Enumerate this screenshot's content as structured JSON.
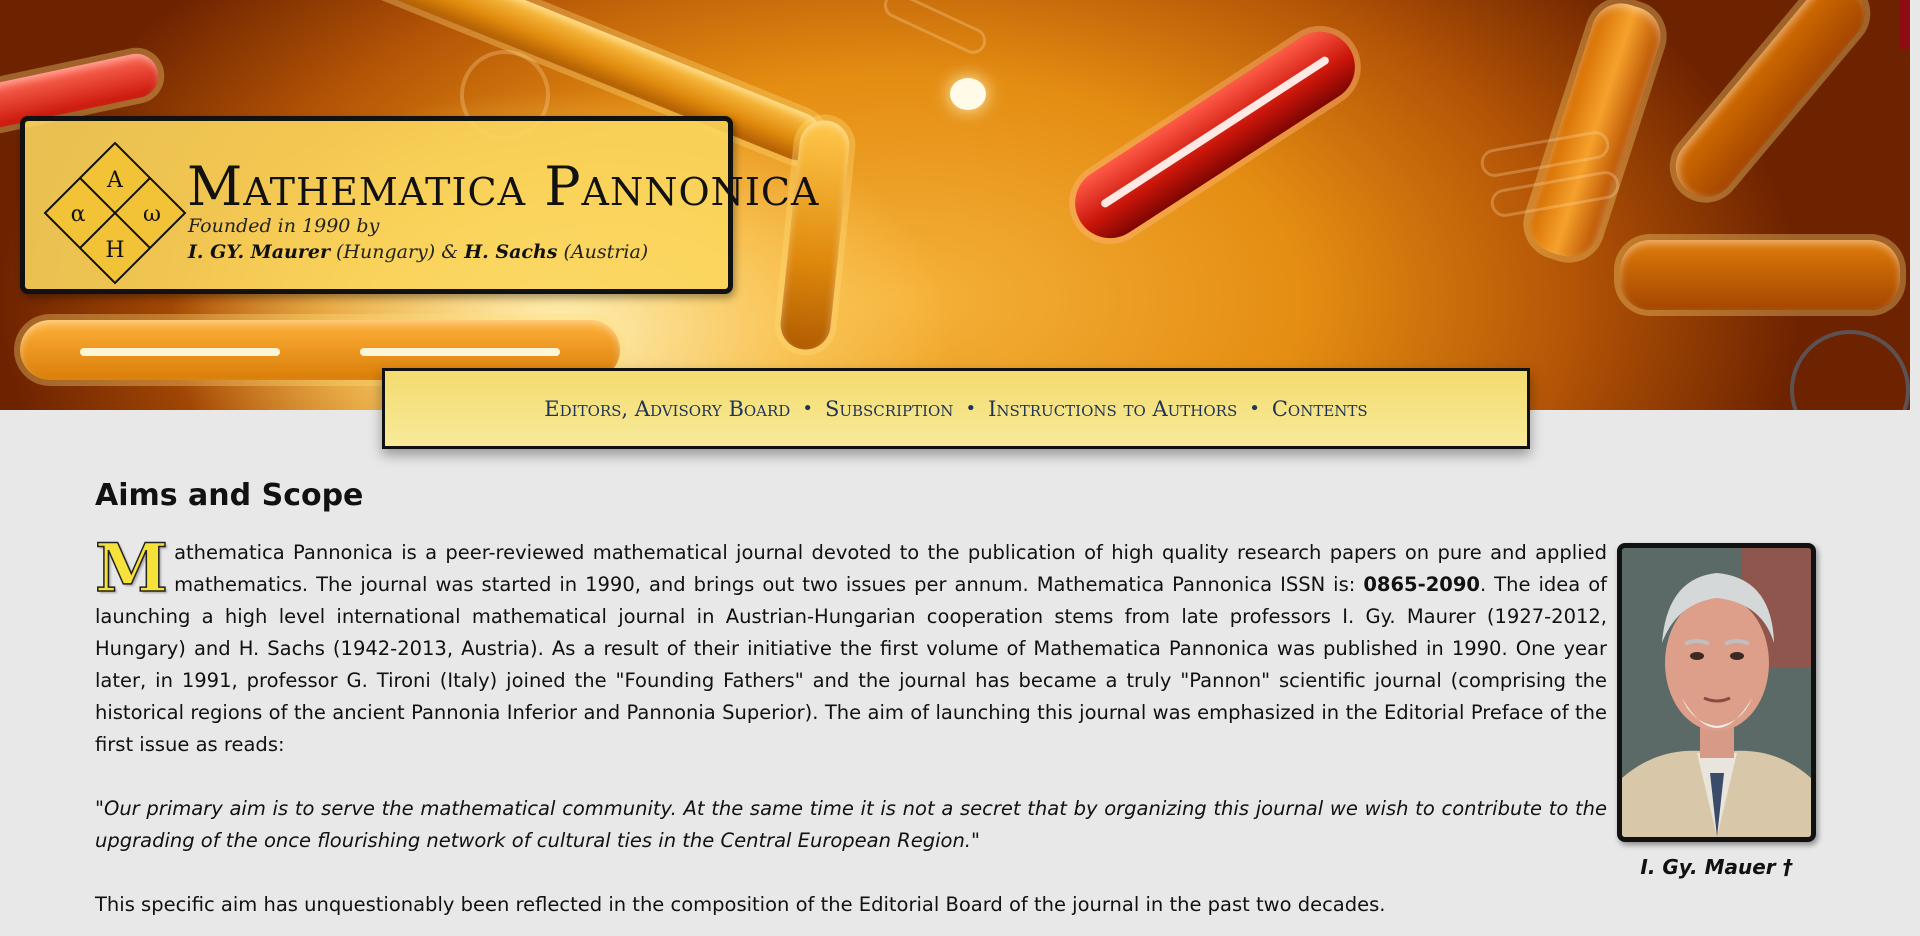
{
  "header": {
    "site_title": "Mathematica Pannonica",
    "founded_line": "Founded in 1990 by",
    "founder1_name": "I. GY. Maurer",
    "founder1_country": "(Hungary)",
    "amp": "&",
    "founder2_name": "H. Sachs",
    "founder2_country": "(Austria)",
    "logo": {
      "top": "A",
      "left": "α",
      "right": "ω",
      "bottom": "H"
    }
  },
  "nav": {
    "items": [
      {
        "label": "Editors, Advisory Board"
      },
      {
        "label": "Subscription"
      },
      {
        "label": "Instructions to Authors"
      },
      {
        "label": "Contents"
      }
    ],
    "separator": "•"
  },
  "main": {
    "heading": "Aims and Scope",
    "dropcap": "M",
    "intro_rest_before_issn": "athematica Pannonica is a peer-reviewed mathematical journal devoted to the publication of high quality research papers on pure and applied mathematics. The journal was started in 1990, and brings out two issues per annum. Mathematica Pannonica ISSN is: ",
    "issn": "0865-2090",
    "intro_rest_after_issn": ". The idea of launching a high level international mathematical journal in Austrian-Hungarian cooperation stems from late professors I. Gy. Maurer (1927-2012, Hungary) and H. Sachs (1942-2013, Austria). As a result of their initiative the first volume of Mathematica Pannonica was published in 1990. One year later, in 1991, professor G. Tironi (Italy) joined the \"Founding Fathers\" and the journal has became a truly \"Pannon\" scientific journal (comprising the historical regions of the ancient Pannonia Inferior and Pannonia Superior). The aim of launching this journal was emphasized in the Editorial Preface of the first issue as reads:",
    "quote": "\"Our primary aim is to serve the mathematical community. At the same time it is not a secret that by organizing this journal we wish to contribute to the upgrading of the once flourishing network of cultural ties in the Central European Region.\"",
    "closing": "This specific aim has unquestionably been reflected in the composition of the Editorial Board of the journal in the past two decades.",
    "portrait_caption": "I. Gy. Mauer †"
  },
  "colors": {
    "nav_link": "#1e3456",
    "title_box_bg": "#fbd65c",
    "page_bg": "#e8e8e8",
    "dropcap": "#f7e23c"
  }
}
